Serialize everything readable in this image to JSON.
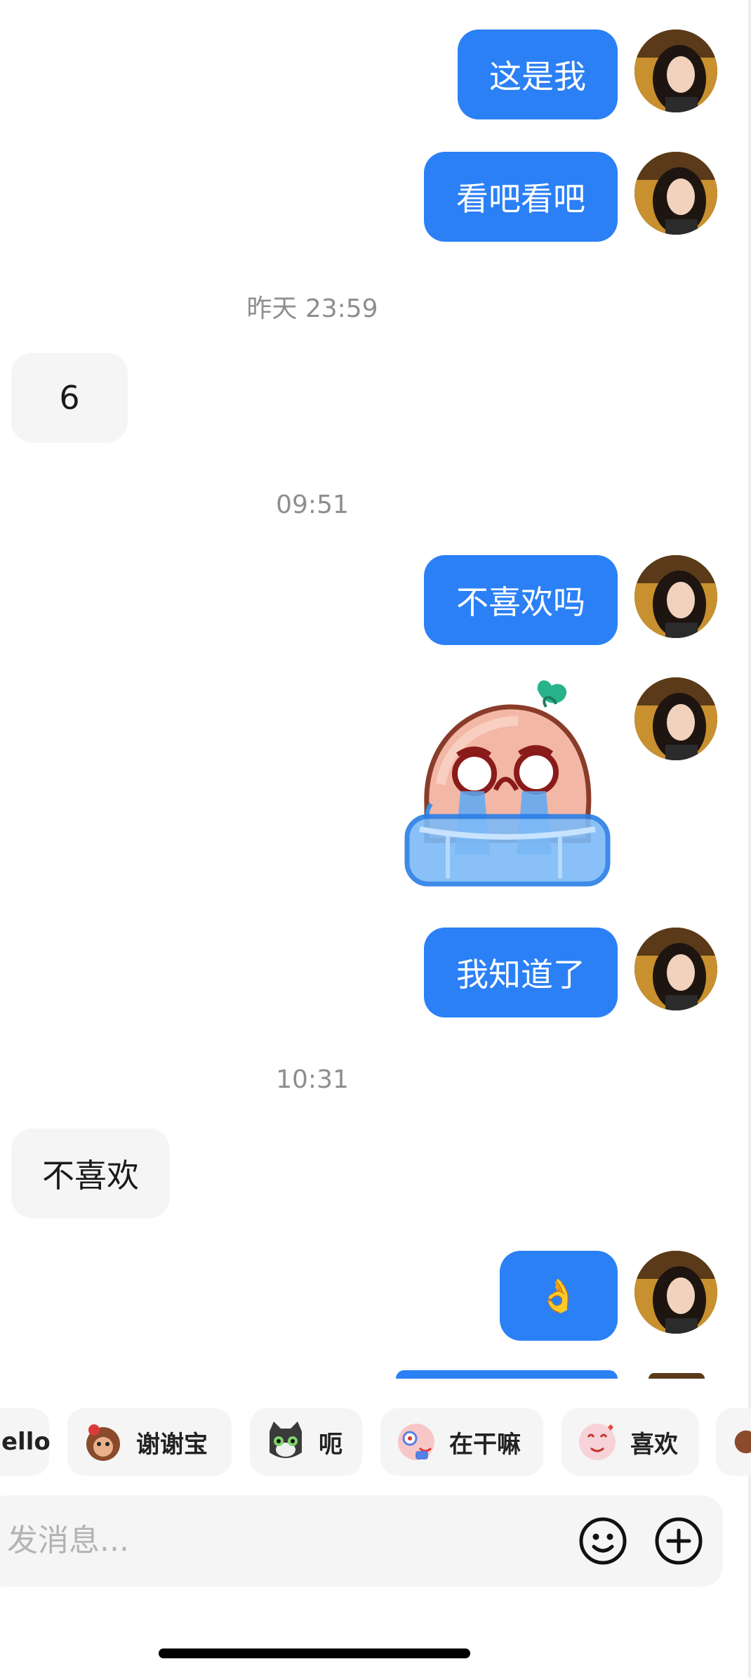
{
  "conversation": {
    "messages": [
      {
        "side": "out",
        "text": "这是我"
      },
      {
        "side": "out",
        "text": "看吧看吧"
      },
      {
        "timestamp": "昨天 23:59"
      },
      {
        "side": "in",
        "text": "6"
      },
      {
        "timestamp": "09:51"
      },
      {
        "side": "out",
        "text": "不喜欢吗"
      },
      {
        "side": "out",
        "sticker": "crying-bun-sticker"
      },
      {
        "side": "out",
        "text": "我知道了"
      },
      {
        "timestamp": "10:31"
      },
      {
        "side": "in",
        "text": "不喜欢"
      },
      {
        "side": "out",
        "text": "👌"
      }
    ]
  },
  "quick_replies": [
    {
      "label": "ello",
      "icon": "none"
    },
    {
      "label": "谢谢宝",
      "icon": "monkey-icon"
    },
    {
      "label": "呃",
      "icon": "cat-icon"
    },
    {
      "label": "在干嘛",
      "icon": "peeking-icon"
    },
    {
      "label": "喜欢",
      "icon": "love-icon"
    }
  ],
  "composer": {
    "placeholder": "发消息...",
    "emoji_icon": "smiley-icon",
    "plus_icon": "plus-icon"
  },
  "colors": {
    "outgoing_bubble": "#2b80f6",
    "incoming_bubble": "#f5f5f5",
    "timestamp_text": "#8e8e8e"
  }
}
